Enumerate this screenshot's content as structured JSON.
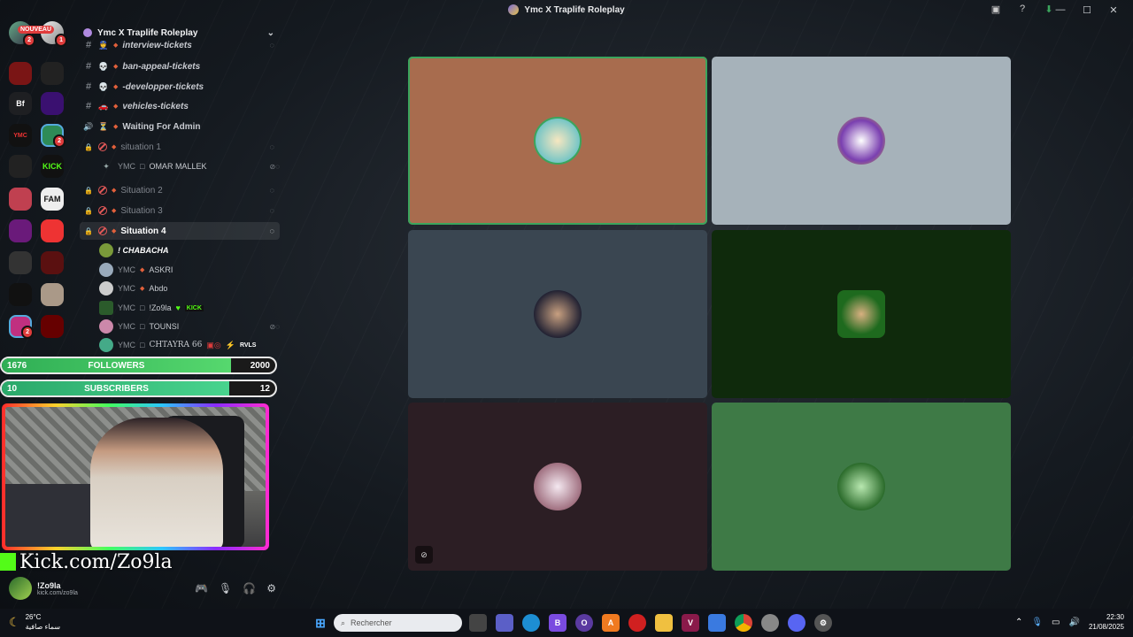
{
  "window": {
    "title": "Ymc X Traplife Roleplay"
  },
  "server_list": {
    "new_badge": "NOUVEAU",
    "bf_label": "Bf",
    "kick_label": "KICK",
    "fam_label": "FAM",
    "ymc_label": "YMC",
    "dm_badge_1": "2",
    "dm_badge_2": "1",
    "badge_a": "2",
    "badge_b": "2"
  },
  "server": {
    "name": "Ymc X Traplife Roleplay"
  },
  "channels": [
    {
      "icon": "#",
      "emoji": "👮",
      "name": "interview-tickets"
    },
    {
      "icon": "#",
      "emoji": "💀",
      "name": "ban-appeal-tickets"
    },
    {
      "icon": "#",
      "emoji": "💀",
      "name": "-developper-tickets"
    },
    {
      "icon": "#",
      "emoji": "🚗",
      "name": "vehicles-tickets"
    },
    {
      "icon": "🔊",
      "emoji": "⏳",
      "name": "Waiting For Admin"
    },
    {
      "icon": "🔒",
      "name": "situation 1"
    },
    {
      "icon": "🔒",
      "name": "Situation 2"
    },
    {
      "icon": "🔒",
      "name": "Situation 3"
    },
    {
      "icon": "🔒",
      "name": "Situation 4"
    }
  ],
  "situation1_users": [
    {
      "tag": "YMC",
      "name": "OMAR MALLEK"
    }
  ],
  "situation4_users": [
    {
      "tag": "",
      "name": "! CHABACHA"
    },
    {
      "tag": "YMC",
      "name": "ASKRI"
    },
    {
      "tag": "YMC",
      "name": "Abdo"
    },
    {
      "tag": "YMC",
      "name": "!Zo9la",
      "extra": "KICK"
    },
    {
      "tag": "YMC",
      "name": "TOUNSI"
    },
    {
      "tag": "YMC",
      "name": "CHTAYRA 66",
      "extra": "RVLS"
    }
  ],
  "followers": {
    "current": "1676",
    "label": "FOLLOWERS",
    "goal": "2000",
    "progress": 0.838
  },
  "subscribers": {
    "current": "10",
    "label": "SUBSCRIBERS",
    "goal": "12",
    "progress": 0.833
  },
  "stream": {
    "url": "Kick.com/Zo9la"
  },
  "user_panel": {
    "name": "!Zo9la",
    "status": "kick.com/zo9la"
  },
  "taskbar": {
    "temp": "26°C",
    "weather": "سماء صافية",
    "search_placeholder": "Rechercher",
    "time": "22:30",
    "date": "21/08/2025"
  },
  "tiles": [
    {
      "color": "#a86c4e",
      "speaking": true
    },
    {
      "color": "#a6b2ba",
      "speaking": false
    },
    {
      "color": "#3a4651",
      "speaking": false
    },
    {
      "color": "#0f2a0c",
      "speaking": false
    },
    {
      "color": "#2c1e24",
      "speaking": false
    },
    {
      "color": "#3e7a46",
      "speaking": false
    }
  ]
}
